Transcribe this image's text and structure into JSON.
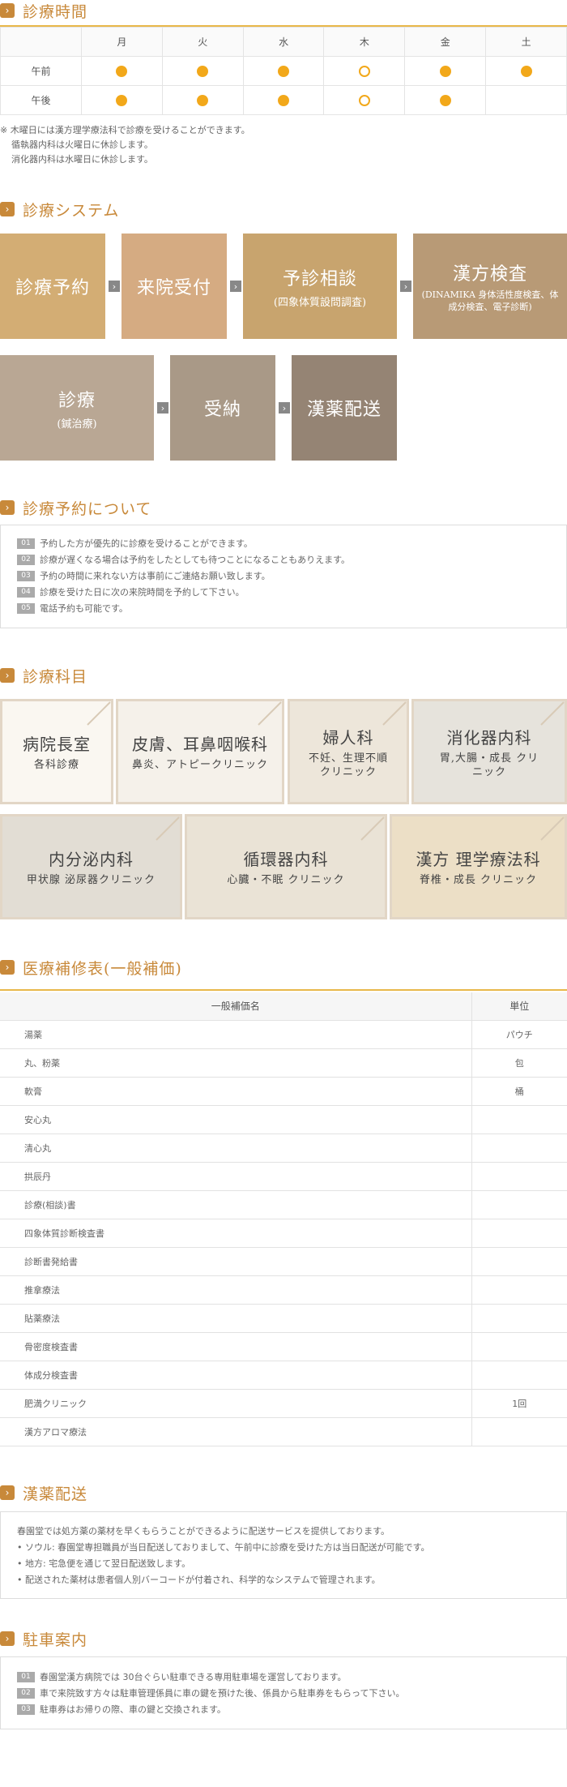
{
  "hours": {
    "title": "診療時間",
    "days": [
      "月",
      "火",
      "水",
      "木",
      "金",
      "土"
    ],
    "rows": [
      {
        "label": "午前",
        "marks": [
          "full",
          "full",
          "full",
          "open",
          "full",
          "full"
        ]
      },
      {
        "label": "午後",
        "marks": [
          "full",
          "full",
          "full",
          "open",
          "full",
          "none"
        ]
      }
    ],
    "notes": [
      "※ 木曜日には漢方理学療法科で診療を受けることができます。",
      "循執器内科は火曜日に休診します。",
      "消化器内科は水曜日に休診します。"
    ]
  },
  "system": {
    "title": "診療システム",
    "steps": [
      {
        "label": "診療予約",
        "sub": "",
        "sub2": "",
        "color": "#d3ad74"
      },
      {
        "label": "来院受付",
        "sub": "",
        "sub2": "",
        "color": "#d5ab82"
      },
      {
        "label": "予診相談",
        "sub": "(四象体質設問調査)",
        "sub2": "",
        "color": "#c8a46e"
      },
      {
        "label": "漢方検査",
        "sub": "",
        "sub2": "(DINAMIKA 身体活性度検査、体成分検査、電子診断)",
        "color": "#b89a76"
      },
      {
        "label": "診療",
        "sub": "(鍼治療)",
        "sub2": "",
        "color": "#b9a794"
      },
      {
        "label": "受納",
        "sub": "",
        "sub2": "",
        "color": "#a99987"
      },
      {
        "label": "漢薬配送",
        "sub": "",
        "sub2": "",
        "color": "#958474"
      }
    ]
  },
  "reservation": {
    "title": "診療予約について",
    "items": [
      {
        "num": "01",
        "text": "予約した方が優先的に診療を受けることができます。"
      },
      {
        "num": "02",
        "text": "診療が遅くなる場合は予約をしたとしても待つことになることもありえます。"
      },
      {
        "num": "03",
        "text": "予約の時間に来れない方は事前にご連絡お願い致します。"
      },
      {
        "num": "04",
        "text": "診療を受けた日に次の来院時間を予約して下さい。"
      },
      {
        "num": "05",
        "text": "電話予約も可能です。"
      }
    ]
  },
  "departments": {
    "title": "診療科目",
    "items": [
      {
        "name": "病院長室",
        "sub": "各科診療",
        "bg": "#faf7f1"
      },
      {
        "name": "皮膚、耳鼻咽喉科",
        "sub": "鼻炎、アトピークリニック",
        "bg": "#f5f1ea"
      },
      {
        "name": "婦人科",
        "sub": "不妊、生理不順 クリニック",
        "bg": "#ede6da"
      },
      {
        "name": "消化器内科",
        "sub": "胃,大腸・成長 クリニック",
        "bg": "#e6e3dc"
      },
      {
        "name": "内分泌内科",
        "sub": "甲状腺 泌尿器クリニック",
        "bg": "#e2ddd4"
      },
      {
        "name": "循環器内科",
        "sub": "心臓・不眠 クリニック",
        "bg": "#eae3d6"
      },
      {
        "name": "漢方 理学療法科",
        "sub": "脊椎・成長 クリニック",
        "bg": "#ecdfc6"
      }
    ]
  },
  "prices": {
    "title": "医療補修表(一般補価)",
    "header": {
      "name": "一般補価名",
      "unit": "単位"
    },
    "rows": [
      {
        "name": "湯薬",
        "unit": "パウチ"
      },
      {
        "name": "丸、粉薬",
        "unit": "包"
      },
      {
        "name": "軟膏",
        "unit": "桶"
      },
      {
        "name": "安心丸",
        "unit": ""
      },
      {
        "name": "清心丸",
        "unit": ""
      },
      {
        "name": "拱辰丹",
        "unit": ""
      },
      {
        "name": "診療(相談)書",
        "unit": ""
      },
      {
        "name": "四象体質診断検査書",
        "unit": ""
      },
      {
        "name": "診断書発給書",
        "unit": ""
      },
      {
        "name": "推拿療法",
        "unit": ""
      },
      {
        "name": "貼薬療法",
        "unit": ""
      },
      {
        "name": "骨密度検査書",
        "unit": ""
      },
      {
        "name": "体成分検査書",
        "unit": ""
      },
      {
        "name": "肥満クリニック",
        "unit": "1回"
      },
      {
        "name": "漢方アロマ療法",
        "unit": ""
      }
    ]
  },
  "delivery": {
    "title": "漢薬配送",
    "lines": [
      "春園堂では処方薬の薬材を早くもらうことができるように配送サービスを提供しております。",
      "• ソウル: 春園堂専担職員が当日配送しておりまして、午前中に診療を受けた方は当日配送が可能です。",
      "• 地方: 宅急便を通じて翌日配送致します。",
      "• 配送された薬材は患者個人別バーコードが付着され、科学的なシステムで管理されます。"
    ]
  },
  "parking": {
    "title": "駐車案内",
    "items": [
      {
        "num": "01",
        "text": "春園堂漢方病院では 30台ぐらい駐車できる専用駐車場を運営しております。"
      },
      {
        "num": "02",
        "text": "車で来院致す方々は駐車管理係員に車の鍵を預けた後、係員から駐車券をもらって下さい。"
      },
      {
        "num": "03",
        "text": "駐車券はお帰りの際、車の鍵と交換されます。"
      }
    ]
  },
  "colors": {
    "accent": "#c8893a",
    "dot": "#f2a81a",
    "rule": "#e8b84a"
  }
}
